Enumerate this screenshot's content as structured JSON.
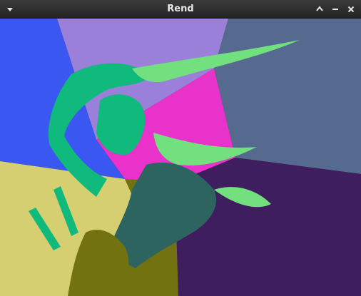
{
  "window": {
    "title": "Rend"
  },
  "icons": {
    "menu": "chevron-down-icon",
    "minimize": "chevron-up-icon",
    "maximize": "minus-icon",
    "close": "close-icon"
  },
  "palette": {
    "blue": "#3a57f2",
    "lavender": "#9a80d8",
    "slate": "#566a90",
    "magenta": "#e832c9",
    "khaki": "#d6cf72",
    "indigo": "#3e1e5e",
    "olive": "#727210",
    "teal_green": "#10b97c",
    "light_green": "#72e07e",
    "dark_teal": "#2e6460"
  }
}
